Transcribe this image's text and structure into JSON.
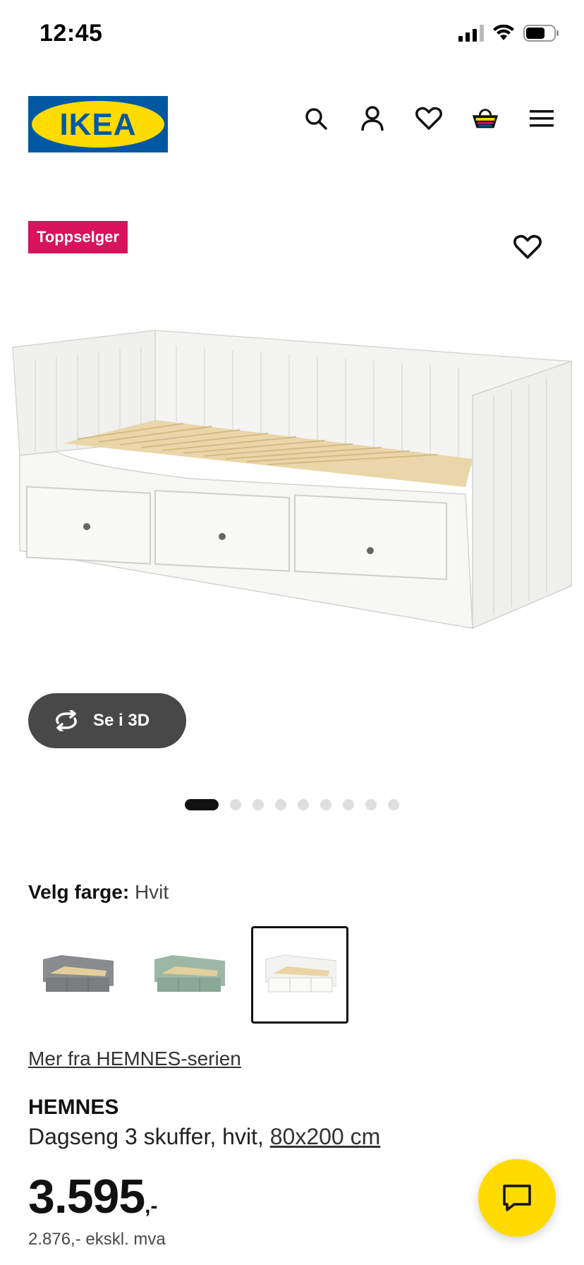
{
  "status_bar": {
    "time": "12:45"
  },
  "header": {
    "logo_text": "IKEA",
    "brand_colors": {
      "blue": "#0058a3",
      "yellow": "#ffdb00"
    },
    "icons": [
      "search-icon",
      "account-icon",
      "favourites-icon",
      "cart-icon",
      "menu-icon"
    ]
  },
  "product": {
    "badge": "Toppselger",
    "badge_color": "#d8125b",
    "view_3d_label": "Se i 3D",
    "carousel": {
      "total": 10,
      "active_index": 0
    },
    "color_label": "Velg farge:",
    "color_value": "Hvit",
    "swatches": [
      {
        "name": "grey",
        "color": "#8a8b8f",
        "selected": false
      },
      {
        "name": "green",
        "color": "#8fae9b",
        "selected": false
      },
      {
        "name": "white",
        "color": "#f1f1ee",
        "selected": true
      }
    ],
    "series_link": "Mer fra HEMNES-serien",
    "name": "HEMNES",
    "description": "Dagseng 3 skuffer, hvit,",
    "size": "80x200 cm",
    "price_main": "3.595",
    "price_suffix": ",-",
    "price_ex_vat": "2.876,- ekskl. mva"
  },
  "chat": {
    "icon": "chat-icon",
    "color": "#ffdb00"
  }
}
